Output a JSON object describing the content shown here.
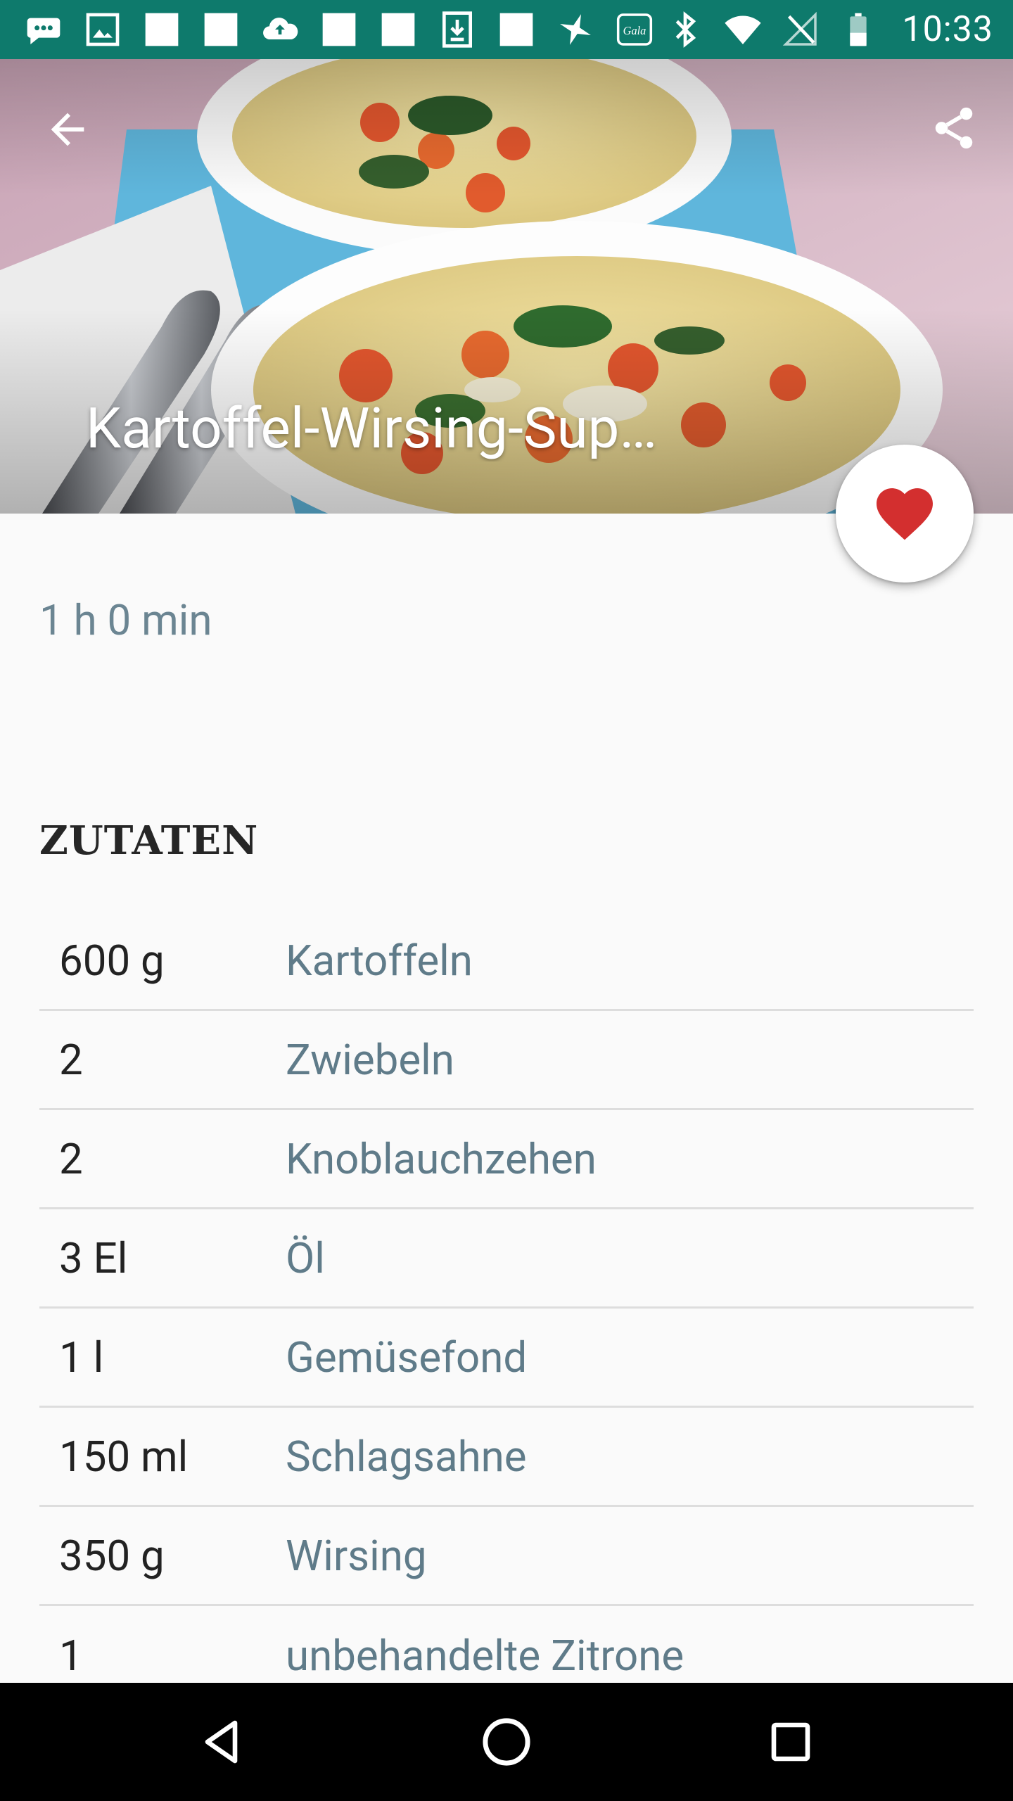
{
  "status_bar": {
    "time": "10:33",
    "left_icons": [
      "messenger-icon",
      "gallery-icon",
      "white-square-icon",
      "white-square-icon",
      "cloud-upload-icon",
      "white-square-icon",
      "white-square-icon",
      "download-icon",
      "white-square-icon",
      "sparkle-icon",
      "gala-app-icon"
    ],
    "gala_label": "Gala",
    "right_icons": [
      "bluetooth-icon",
      "wifi-icon",
      "no-signal-icon",
      "battery-icon"
    ]
  },
  "recipe": {
    "title": "Kartoffel-Wirsing-Sup…",
    "cook_time": "1 h 0 min",
    "favorite": true
  },
  "ingredients_section": {
    "title": "ZUTATEN",
    "items": [
      {
        "qty": "600 g",
        "name": "Kartoffeln"
      },
      {
        "qty": "2",
        "name": "Zwiebeln"
      },
      {
        "qty": "2",
        "name": "Knoblauchzehen"
      },
      {
        "qty": "3 El",
        "name": "Öl"
      },
      {
        "qty": "1 l",
        "name": "Gemüsefond"
      },
      {
        "qty": "150 ml",
        "name": "Schlagsahne"
      },
      {
        "qty": "350 g",
        "name": "Wirsing"
      },
      {
        "qty": "1",
        "name": "unbehandelte Zitrone"
      }
    ]
  },
  "colors": {
    "status_bar": "#0e7a6c",
    "accent_heart": "#d32f2f",
    "muted_text": "#5f7b89"
  }
}
